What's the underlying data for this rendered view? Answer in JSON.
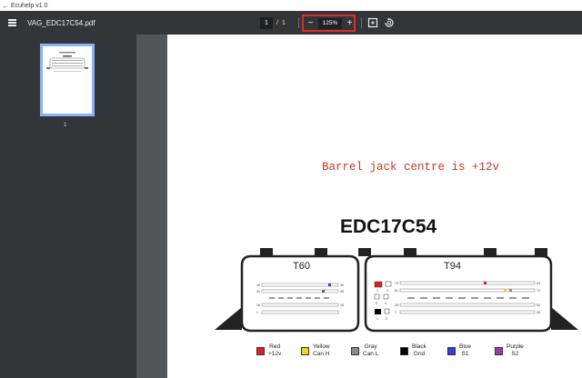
{
  "window": {
    "back_glyph": "←",
    "title": "Ecuhelp v1.0"
  },
  "toolbar": {
    "filename": "VAG_EDC17C54.pdf",
    "page_current": "1",
    "page_separator": "/",
    "page_total": "1",
    "zoom_out": "−",
    "zoom_level": "125%",
    "zoom_in": "+",
    "highlight_color": "#e12a2a"
  },
  "sidebar": {
    "thumbnails": [
      {
        "page_label": "1"
      }
    ]
  },
  "document": {
    "note": "Barrel jack centre is +12v",
    "model": "EDC17C54",
    "connectors": {
      "t60": {
        "label": "T60",
        "pins": [
          "40",
          "30",
          "31",
          "45",
          "16",
          "15",
          "1",
          "..."
        ]
      },
      "t94": {
        "label": "T94",
        "pins": [
          "73",
          "94",
          "51",
          "72",
          "29",
          "50",
          "7",
          "28"
        ]
      }
    },
    "legend_top": [
      {
        "line1": "Red",
        "line2": "+12v",
        "color": "#e02020"
      },
      {
        "line1": "Yellow",
        "line2": "Can H",
        "color": "#f2d21b"
      },
      {
        "line1": "Gray",
        "line2": "Can L",
        "color": "#8a8a8a"
      },
      {
        "line1": "Black",
        "line2": "Gnd",
        "color": "#000000"
      },
      {
        "line1": "Blue",
        "line2": "S1",
        "color": "#2d3fd4"
      },
      {
        "line1": "Purple",
        "line2": "S2",
        "color": "#9b3aa8"
      }
    ],
    "t94_side_labels": [
      "1",
      "2",
      "3",
      "4",
      "1",
      "2"
    ]
  }
}
